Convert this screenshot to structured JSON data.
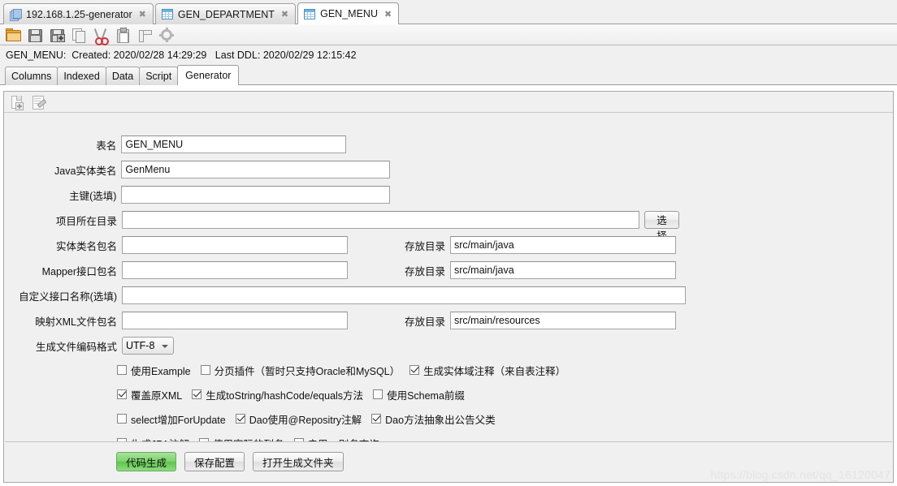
{
  "window": {
    "tabs": [
      {
        "label": "192.168.1.25-generator",
        "icon": "stack-icon",
        "active": false,
        "close": "✖"
      },
      {
        "label": "GEN_DEPARTMENT",
        "icon": "table-grid-icon",
        "active": false,
        "close": "✖"
      },
      {
        "label": "GEN_MENU",
        "icon": "table-grid-icon",
        "active": true,
        "close": "✖"
      }
    ]
  },
  "toolbar": {
    "items": [
      {
        "name": "open-folder-icon",
        "title": "Open"
      },
      {
        "name": "save-icon",
        "title": "Save"
      },
      {
        "name": "save-as-icon",
        "title": "Save As"
      },
      {
        "name": "copy-icon",
        "title": "Copy"
      },
      {
        "name": "cut-icon",
        "title": "Cut"
      },
      {
        "name": "paste-icon",
        "title": "Paste"
      },
      {
        "name": "ruler-icon",
        "title": "Format"
      },
      {
        "name": "gear-icon",
        "title": "Settings"
      }
    ]
  },
  "info": {
    "text": "GEN_MENU:  Created: 2020/02/28 14:29:29   Last DDL: 2020/02/29 12:15:42"
  },
  "subtabs": [
    {
      "label": "Columns",
      "active": false
    },
    {
      "label": "Indexed",
      "active": false
    },
    {
      "label": "Data",
      "active": false
    },
    {
      "label": "Script",
      "active": false
    },
    {
      "label": "Generator",
      "active": true
    }
  ],
  "mini_toolbar": {
    "items": [
      {
        "name": "new-document-icon"
      },
      {
        "name": "edit-document-icon"
      }
    ]
  },
  "form": {
    "fields": [
      {
        "label": "表名",
        "value": "GEN_MENU",
        "placeholder": ""
      },
      {
        "label": "Java实体类名",
        "value": "GenMenu",
        "placeholder": ""
      },
      {
        "label": "主键(选填)",
        "value": "",
        "placeholder": ""
      },
      {
        "label": "项目所在目录",
        "value": "",
        "placeholder": ""
      },
      {
        "label": "实体类名包名",
        "value": "",
        "placeholder": ""
      },
      {
        "label": "Mapper接口包名",
        "value": "",
        "placeholder": ""
      },
      {
        "label": "自定义接口名称(选填)",
        "value": "",
        "placeholder": ""
      },
      {
        "label": "映射XML文件包名",
        "value": "",
        "placeholder": ""
      }
    ],
    "browse_button": "选择",
    "dir_label": "存放目录",
    "dir_values": {
      "entity": "src/main/java",
      "mapper": "src/main/java",
      "xml": "src/main/resources"
    },
    "encoding_label": "生成文件编码格式",
    "encoding_value": "UTF-8"
  },
  "checkboxes": {
    "row1": [
      {
        "label": "使用Example",
        "checked": false
      },
      {
        "label": "分页插件（暂时只支持Oracle和MySQL）",
        "checked": false
      },
      {
        "label": "生成实体域注释（来自表注释）",
        "checked": true
      }
    ],
    "row2": [
      {
        "label": "覆盖原XML",
        "checked": true
      },
      {
        "label": "生成toString/hashCode/equals方法",
        "checked": true
      },
      {
        "label": "使用Schema前缀",
        "checked": false
      }
    ],
    "row3": [
      {
        "label": "select增加ForUpdate",
        "checked": false
      },
      {
        "label": "Dao使用@Repositry注解",
        "checked": true
      },
      {
        "label": "Dao方法抽象出公告父类",
        "checked": true
      }
    ],
    "row4": [
      {
        "label": "生成JPA注解",
        "checked": false
      },
      {
        "label": "使用实际的列名",
        "checked": false
      },
      {
        "label": "启用as别名查询",
        "checked": false
      }
    ]
  },
  "footer": {
    "buttons": [
      {
        "label": "代码生成",
        "style": "green"
      },
      {
        "label": "保存配置",
        "style": "normal"
      },
      {
        "label": "打开生成文件夹",
        "style": "normal"
      }
    ]
  },
  "watermark": "https://blog.csdn.net/qq_16120047",
  "colors": {
    "accent_green": "#7fd36f",
    "panel_bg": "#f0f0f0",
    "field_bg": "#ffffff"
  }
}
